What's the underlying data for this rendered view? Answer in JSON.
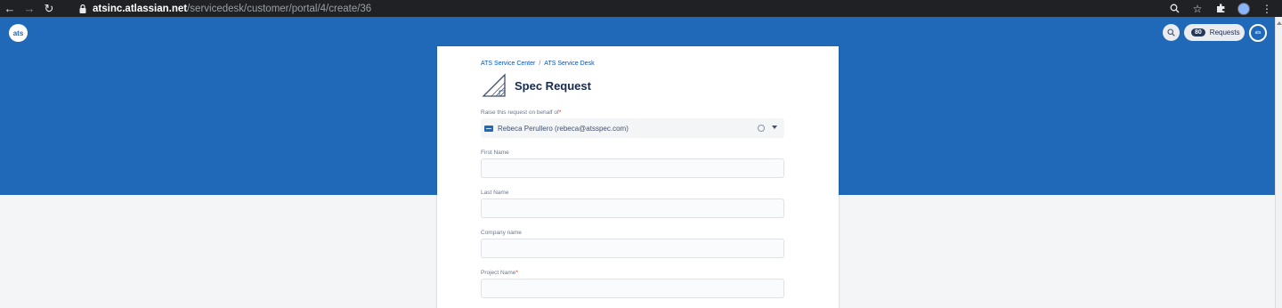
{
  "browser": {
    "url_host": "atsinc.atlassian.net",
    "url_path": "/servicedesk/customer/portal/4/create/36"
  },
  "header": {
    "logo_text": "ats",
    "requests_count": "80",
    "requests_label": "Requests"
  },
  "breadcrumb": {
    "items": [
      "ATS Service Center",
      "ATS Service Desk"
    ],
    "separator": "/"
  },
  "form": {
    "title": "Spec Request",
    "fields": [
      {
        "label": "Raise this request on behalf of",
        "required": true,
        "value": "Rebeca Perullero (rebeca@atsspec.com)"
      },
      {
        "label": "First Name",
        "required": false,
        "value": ""
      },
      {
        "label": "Last Name",
        "required": false,
        "value": ""
      },
      {
        "label": "Company name",
        "required": false,
        "value": ""
      },
      {
        "label": "Project Name",
        "required": true,
        "value": ""
      }
    ],
    "required_mark": "*"
  },
  "colors": {
    "hero": "#2069b8",
    "link": "#0052cc"
  }
}
